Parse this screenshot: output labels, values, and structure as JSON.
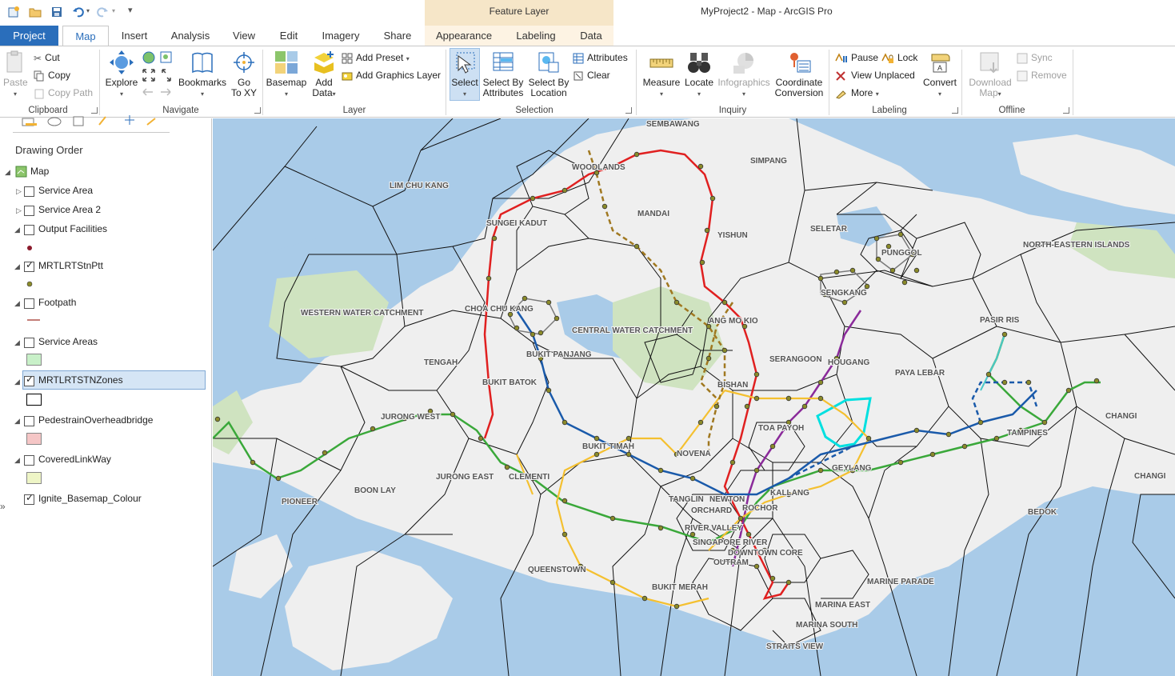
{
  "app": {
    "title": "MyProject2 - Map - ArcGIS Pro",
    "contextual_header": "Feature Layer"
  },
  "quick_access": {
    "icons": [
      "new-project-icon",
      "open-folder-icon",
      "save-icon",
      "undo-icon",
      "redo-icon",
      "customize-qat-icon"
    ]
  },
  "tabs": [
    {
      "label": "Project"
    },
    {
      "label": "Map"
    },
    {
      "label": "Insert"
    },
    {
      "label": "Analysis"
    },
    {
      "label": "View"
    },
    {
      "label": "Edit"
    },
    {
      "label": "Imagery"
    },
    {
      "label": "Share"
    },
    {
      "label": "Appearance"
    },
    {
      "label": "Labeling"
    },
    {
      "label": "Data"
    }
  ],
  "ribbon": {
    "clipboard": {
      "label": "Clipboard",
      "paste": "Paste",
      "cut": "Cut",
      "copy": "Copy",
      "copy_path": "Copy Path"
    },
    "navigate": {
      "label": "Navigate",
      "explore": "Explore",
      "bookmarks": "Bookmarks",
      "go_to_xy_1": "Go",
      "go_to_xy_2": "To XY"
    },
    "layer": {
      "label": "Layer",
      "basemap": "Basemap",
      "add_data_1": "Add",
      "add_data_2": "Data",
      "add_preset": "Add Preset",
      "add_graphics_layer": "Add Graphics Layer"
    },
    "selection": {
      "label": "Selection",
      "select": "Select",
      "select_by_attr_1": "Select By",
      "select_by_attr_2": "Attributes",
      "select_by_loc_1": "Select By",
      "select_by_loc_2": "Location",
      "attributes": "Attributes",
      "clear": "Clear"
    },
    "inquiry": {
      "label": "Inquiry",
      "measure": "Measure",
      "locate": "Locate",
      "infographics": "Infographics",
      "coord_conv_1": "Coordinate",
      "coord_conv_2": "Conversion"
    },
    "labeling": {
      "label": "Labeling",
      "pause": "Pause",
      "lock": "Lock",
      "view_unplaced": "View Unplaced",
      "more": "More",
      "convert": "Convert"
    },
    "offline": {
      "label": "Offline",
      "download_map_1": "Download",
      "download_map_2": "Map",
      "sync": "Sync",
      "remove": "Remove"
    }
  },
  "contents": {
    "heading": "Drawing Order",
    "map_label": "Map",
    "layers": [
      {
        "name": "Service Area",
        "checked": false
      },
      {
        "name": "Service Area 2",
        "checked": false
      },
      {
        "name": "Output Facilities",
        "checked": false
      },
      {
        "name": "MRTLRTStnPtt",
        "checked": true
      },
      {
        "name": "Footpath",
        "checked": false
      },
      {
        "name": "Service Areas",
        "checked": false
      },
      {
        "name": "MRTLRTSTNZones",
        "checked": true
      },
      {
        "name": "PedestrainOverheadbridge",
        "checked": false
      },
      {
        "name": "CoveredLinkWay",
        "checked": false
      },
      {
        "name": "Ignite_Basemap_Colour",
        "checked": true
      }
    ],
    "swatch_colors": {
      "output_facilities": "#8b1a2c",
      "mrt_stn": "#8b8b2a",
      "footpath": "#b0524a",
      "service_areas": "#c8f0c8",
      "zones": "#000000",
      "overhead_bridge": "#f5c6c6",
      "covered_link": "#eef5c6"
    }
  },
  "map": {
    "colors": {
      "water": "#a9cbe8",
      "land": "#efefef",
      "green": "#cfe3c0",
      "red_line": "#e02020",
      "green_line": "#3aa83a",
      "purple_line": "#8a2a9a",
      "yellow_line": "#f4c030",
      "blue_line": "#1a5aaa",
      "brown_line": "#a07820",
      "selected_zone": "#00e0e0"
    },
    "labels": [
      {
        "text": "SEMBAWANG"
      },
      {
        "text": "WOODLANDS"
      },
      {
        "text": "SIMPANG"
      },
      {
        "text": "LIM CHU KANG"
      },
      {
        "text": "MANDAI"
      },
      {
        "text": "SUNGEI KADUT"
      },
      {
        "text": "YISHUN"
      },
      {
        "text": "SELETAR"
      },
      {
        "text": "PUNGGOL"
      },
      {
        "text": "NORTH-EASTERN ISLANDS"
      },
      {
        "text": "SENGKANG"
      },
      {
        "text": "WESTERN WATER CATCHMENT"
      },
      {
        "text": "CHOA CHU KANG"
      },
      {
        "text": "CENTRAL WATER CATCHMENT"
      },
      {
        "text": "ANG MO KIO"
      },
      {
        "text": "PASIR RIS"
      },
      {
        "text": "BUKIT PANJANG"
      },
      {
        "text": "SERANGOON"
      },
      {
        "text": "HOUGANG"
      },
      {
        "text": "TENGAH"
      },
      {
        "text": "PAYA LEBAR"
      },
      {
        "text": "BUKIT BATOK"
      },
      {
        "text": "BISHAN"
      },
      {
        "text": "CHANGI"
      },
      {
        "text": "JURONG WEST"
      },
      {
        "text": "TOA PAYOH"
      },
      {
        "text": "TAMPINES"
      },
      {
        "text": "BUKIT TIMAH"
      },
      {
        "text": "NOVENA"
      },
      {
        "text": "GEYLANG"
      },
      {
        "text": "JURONG EAST"
      },
      {
        "text": "CLEMENTI"
      },
      {
        "text": "BOON LAY"
      },
      {
        "text": "PIONEER"
      },
      {
        "text": "TANGLIN"
      },
      {
        "text": "NEWTON"
      },
      {
        "text": "ORCHARD"
      },
      {
        "text": "ROCHOR"
      },
      {
        "text": "KALLANG"
      },
      {
        "text": "CHANGI"
      },
      {
        "text": "BEDOK"
      },
      {
        "text": "RIVER VALLEY"
      },
      {
        "text": "SINGAPORE RIVER"
      },
      {
        "text": "DOWNTOWN CORE"
      },
      {
        "text": "OUTRAM"
      },
      {
        "text": "QUEENSTOWN"
      },
      {
        "text": "MARINE PARADE"
      },
      {
        "text": "BUKIT MERAH"
      },
      {
        "text": "MARINA EAST"
      },
      {
        "text": "MARINA SOUTH"
      },
      {
        "text": "STRAITS VIEW"
      }
    ]
  }
}
